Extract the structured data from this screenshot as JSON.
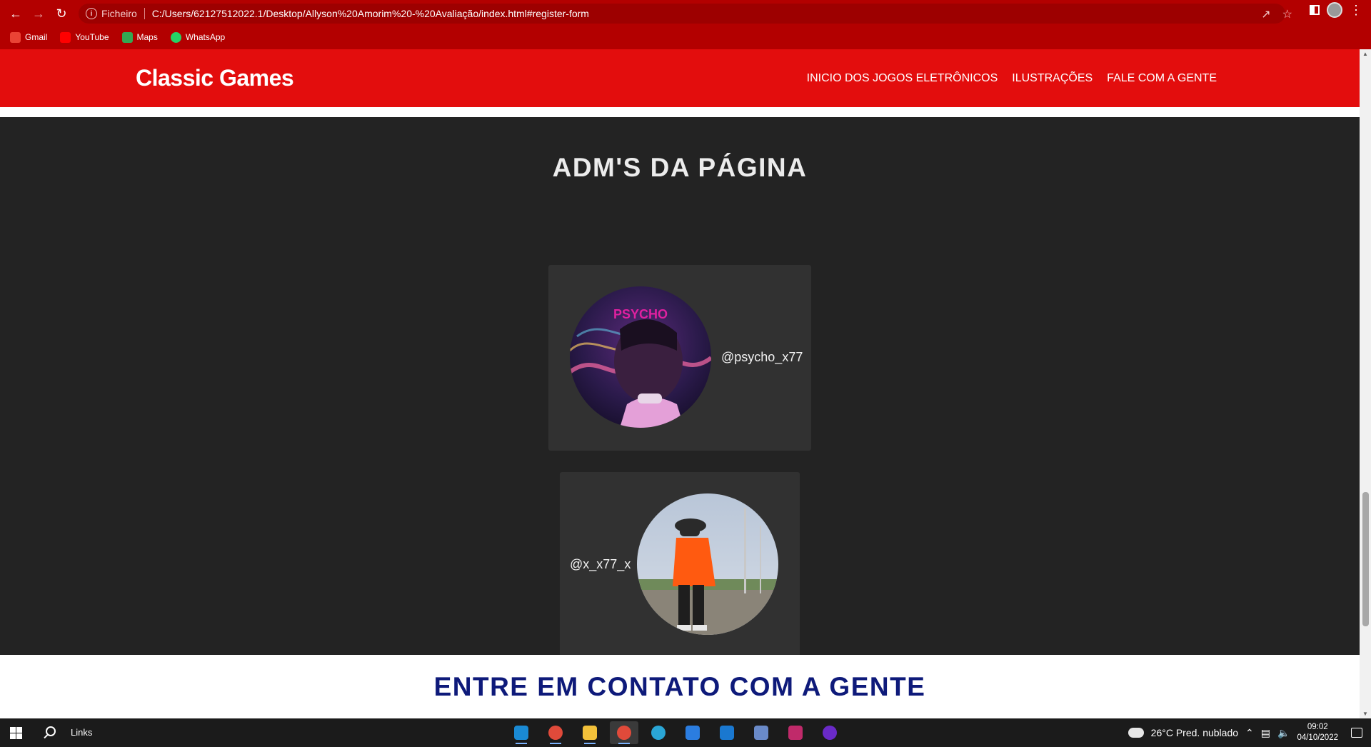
{
  "browser": {
    "scheme_label": "Ficheiro",
    "url": "C:/Users/62127512022.1/Desktop/Allyson%20Amorim%20-%20Avaliação/index.html#register-form",
    "bookmarks": [
      {
        "label": "Gmail",
        "icon": "gmail-icon",
        "color": "#ea4335"
      },
      {
        "label": "YouTube",
        "icon": "youtube-icon",
        "color": "#ff0000"
      },
      {
        "label": "Maps",
        "icon": "maps-icon",
        "color": "#34a853"
      },
      {
        "label": "WhatsApp",
        "icon": "whatsapp-icon",
        "color": "#25d366"
      }
    ]
  },
  "site": {
    "brand": "Classic Games",
    "nav": [
      {
        "label": "INICIO DOS JOGOS ELETRÔNICOS"
      },
      {
        "label": "ILUSTRAÇÕES"
      },
      {
        "label": "FALE COM A GENTE"
      }
    ],
    "admins_title": "ADM'S DA PÁGINA",
    "admins": [
      {
        "handle": "@psycho_x77",
        "avatar_text": "PSYCHO"
      },
      {
        "handle": "@x_x77_x"
      }
    ],
    "contact_title": "ENTRE EM CONTATO COM A GENTE"
  },
  "colors": {
    "header_red": "#e30d0d",
    "chrome_red": "#b30000",
    "dark_bg": "#232323",
    "card_bg": "#313131",
    "contact_title": "#0e1a7a"
  },
  "taskbar": {
    "search_label": "Links",
    "weather": "26°C  Pred. nublado",
    "time": "09:02",
    "date": "04/10/2022"
  }
}
